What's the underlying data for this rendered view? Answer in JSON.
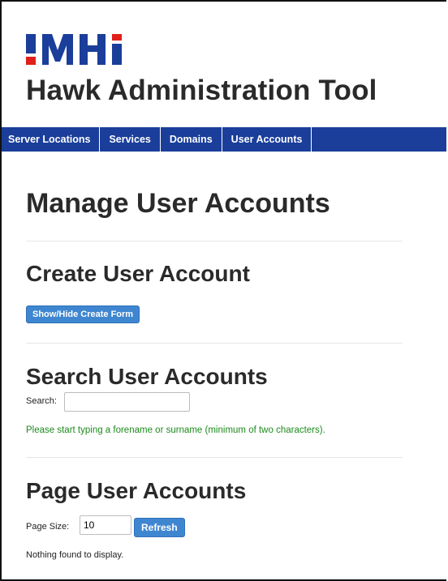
{
  "header": {
    "logo_text": "MHI",
    "app_title": "Hawk Administration Tool"
  },
  "nav": {
    "items": [
      {
        "label": "Server Locations"
      },
      {
        "label": "Services"
      },
      {
        "label": "Domains"
      },
      {
        "label": "User Accounts"
      }
    ]
  },
  "main": {
    "page_title": "Manage User Accounts",
    "create": {
      "title": "Create User Account",
      "toggle_button": "Show/Hide Create Form"
    },
    "search": {
      "title": "Search User Accounts",
      "label": "Search:",
      "value": "",
      "placeholder": "",
      "hint": "Please start typing a forename or surname (minimum of two characters)."
    },
    "paging": {
      "title": "Page User Accounts",
      "page_size_label": "Page Size:",
      "page_size_value": "10",
      "refresh_button": "Refresh",
      "empty_message": "Nothing found to display."
    }
  },
  "colors": {
    "navbar": "#1a3e9a",
    "logo_red": "#e0201a",
    "logo_blue": "#1a3e9a",
    "button": "#3f86d0",
    "hint_text": "#1c8a1c"
  }
}
